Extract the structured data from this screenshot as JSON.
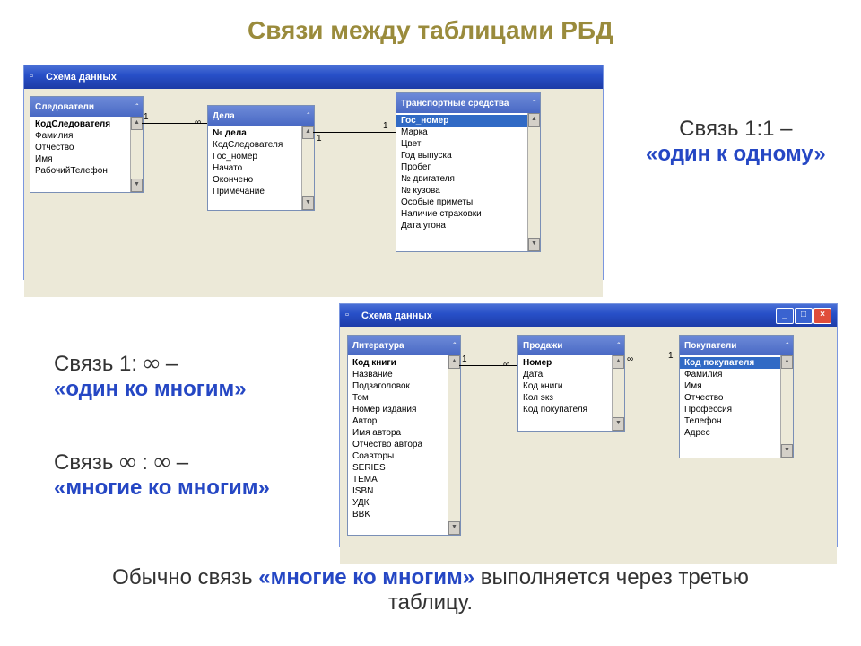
{
  "title": "Связи между таблицами РБД",
  "window1": {
    "title": "Схема данных",
    "tables": [
      {
        "name": "Следователи",
        "fields": [
          "КодСледователя",
          "Фамилия",
          "Отчество",
          "Имя",
          "РабочийТелефон"
        ],
        "bold": [
          0
        ],
        "sel": []
      },
      {
        "name": "Дела",
        "fields": [
          "№ дела",
          "КодСледователя",
          "Гос_номер",
          "Начато",
          "Окончено",
          "Примечание"
        ],
        "bold": [
          0
        ],
        "sel": []
      },
      {
        "name": "Транспортные средства",
        "fields": [
          "Гос_номер",
          "Марка",
          "Цвет",
          "Год выпуска",
          "Пробег",
          "№ двигателя",
          "№ кузова",
          "Особые приметы",
          "Наличие страховки",
          "Дата угона"
        ],
        "bold": [
          0
        ],
        "sel": [
          0
        ]
      }
    ],
    "labels": {
      "one": "1",
      "many": "∞"
    }
  },
  "window2": {
    "title": "Схема данных",
    "tables": [
      {
        "name": "Литература",
        "fields": [
          "Код книги",
          "Название",
          "Подзаголовок",
          "Том",
          "Номер издания",
          "Автор",
          "Имя автора",
          "Отчество автора",
          "Соавторы",
          "SERIES",
          "TEMA",
          "ISBN",
          "УДК",
          "BBK"
        ],
        "bold": [
          0
        ],
        "sel": []
      },
      {
        "name": "Продажи",
        "fields": [
          "Номер",
          "Дата",
          "Код книги",
          "Кол экз",
          "Код покупателя"
        ],
        "bold": [
          0
        ],
        "sel": []
      },
      {
        "name": "Покупатели",
        "fields": [
          "Код покупателя",
          "Фамилия",
          "Имя",
          "Отчество",
          "Профессия",
          "Телефон",
          "Адрес"
        ],
        "bold": [
          0
        ],
        "sel": [
          0
        ]
      }
    ],
    "labels": {
      "one": "1",
      "many": "∞"
    }
  },
  "captions": {
    "c1a": "Связь 1:1 –",
    "c1b": "«один к одному»",
    "c2a": "Связь 1: ",
    "c2b": " –",
    "c2c": "«один ко многим»",
    "c3a": "Связь ",
    "c3b": " : ",
    "c3c": " –",
    "c3d": "«многие ко многим»",
    "c4a": "Обычно связь ",
    "c4b": "«многие ко многим»",
    "c4c": " выполняется через третью таблицу."
  },
  "win_btns": {
    "min": "_",
    "max": "□",
    "close": "×"
  }
}
